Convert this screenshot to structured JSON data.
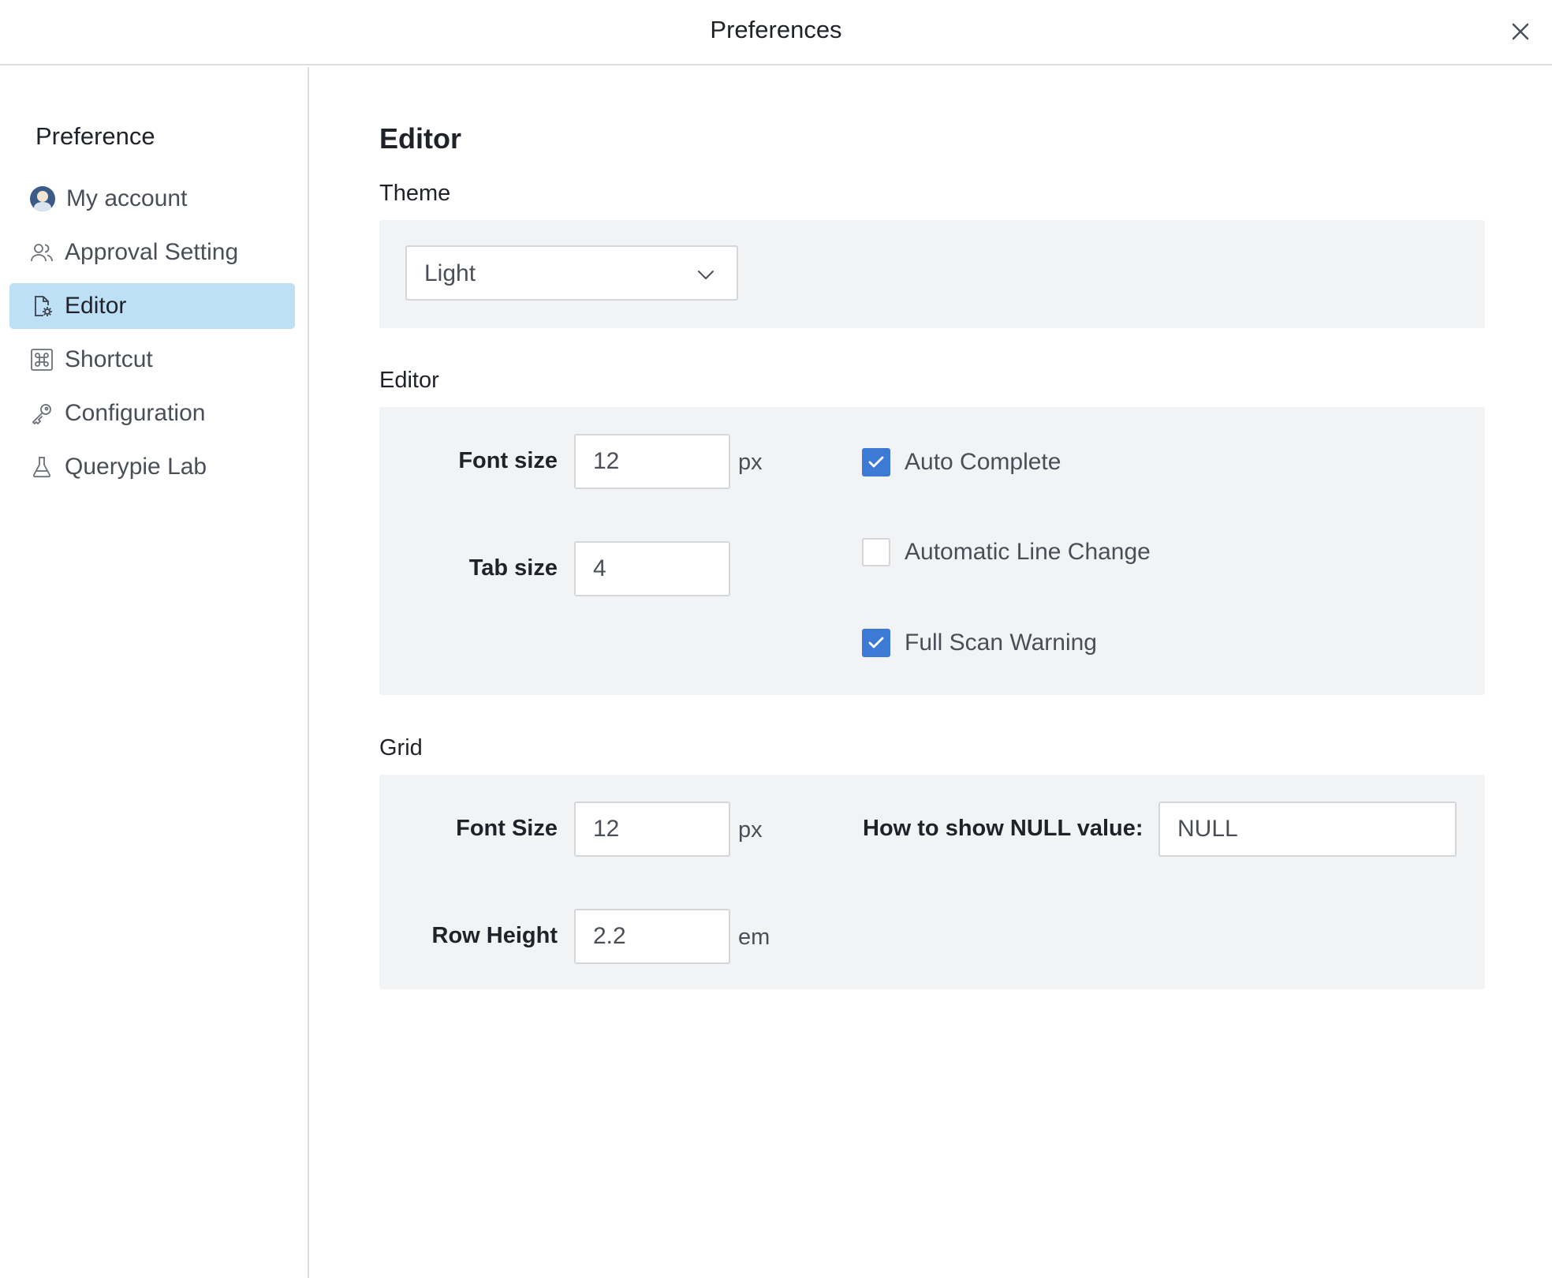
{
  "window": {
    "title": "Preferences"
  },
  "sidebar": {
    "heading": "Preference",
    "items": [
      {
        "label": "My account",
        "icon": "avatar-icon",
        "active": false
      },
      {
        "label": "Approval Setting",
        "icon": "users-icon",
        "active": false
      },
      {
        "label": "Editor",
        "icon": "file-gear-icon",
        "active": true
      },
      {
        "label": "Shortcut",
        "icon": "command-key-icon",
        "active": false
      },
      {
        "label": "Configuration",
        "icon": "key-icon",
        "active": false
      },
      {
        "label": "Querypie Lab",
        "icon": "flask-icon",
        "active": false
      }
    ]
  },
  "main": {
    "title": "Editor",
    "theme": {
      "label": "Theme",
      "selected": "Light"
    },
    "editor": {
      "label": "Editor",
      "font_size_label": "Font size",
      "font_size_value": "12",
      "font_size_unit": "px",
      "tab_size_label": "Tab size",
      "tab_size_value": "4",
      "auto_complete": {
        "label": "Auto Complete",
        "checked": true
      },
      "auto_line_change": {
        "label": "Automatic Line Change",
        "checked": false
      },
      "full_scan_warning": {
        "label": "Full Scan Warning",
        "checked": true
      }
    },
    "grid": {
      "label": "Grid",
      "font_size_label": "Font Size",
      "font_size_value": "12",
      "font_size_unit": "px",
      "row_height_label": "Row Height",
      "row_height_value": "2.2",
      "row_height_unit": "em",
      "null_label": "How to show NULL value:",
      "null_value": "NULL"
    }
  },
  "colors": {
    "accent": "#3d7ad6",
    "active_nav_bg": "#bde0f7",
    "panel_bg": "#f2f3f5",
    "border": "#d4d6da"
  }
}
